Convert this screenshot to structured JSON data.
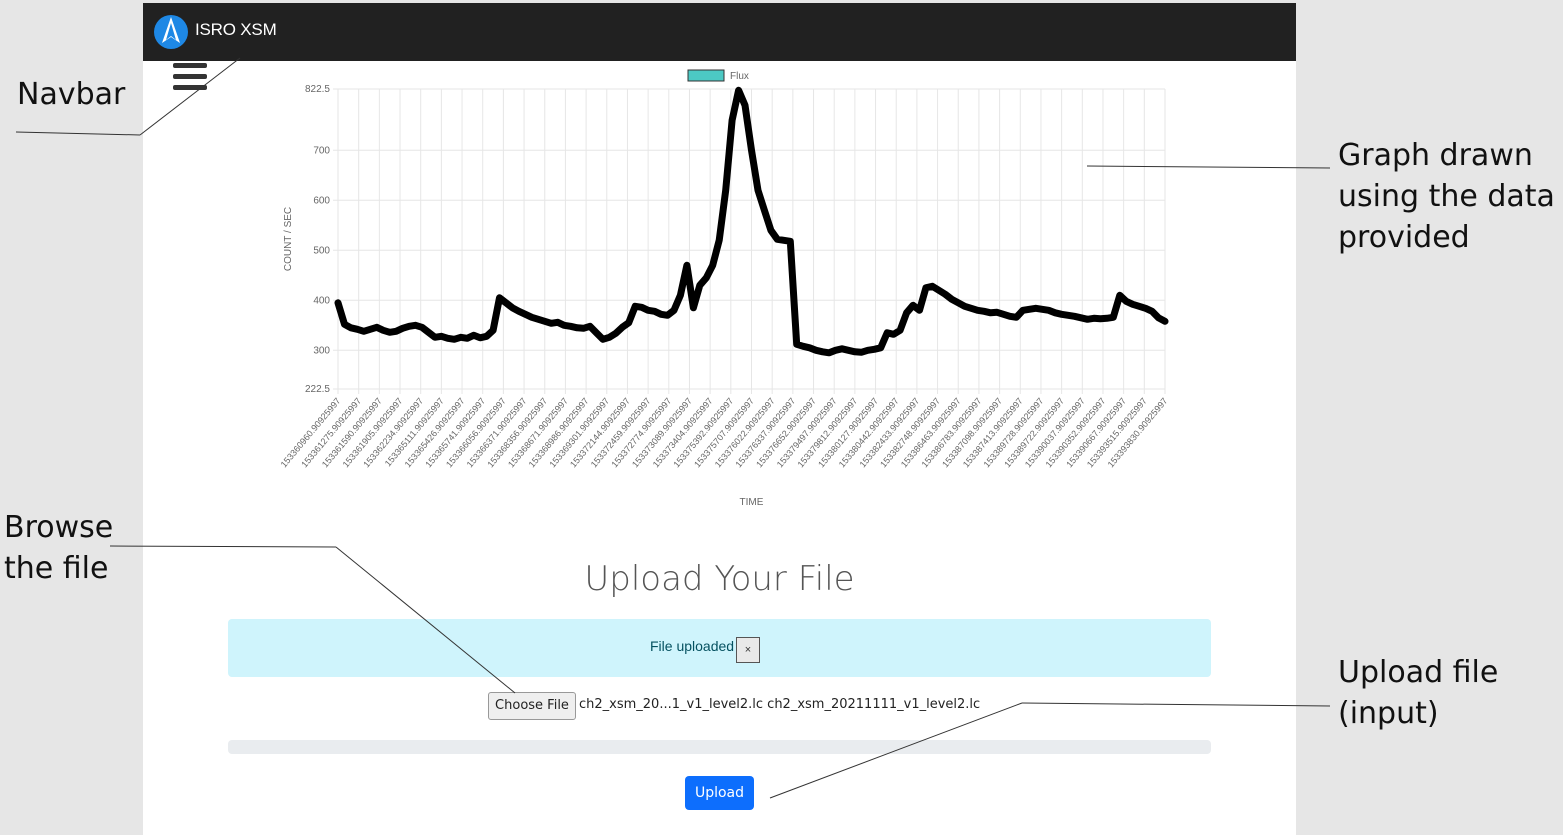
{
  "navbar": {
    "brand": "ISRO XSM",
    "logo_icon": "isro-logo-icon",
    "menu_icon": "hamburger-menu-icon",
    "background": "#212121"
  },
  "chart_data": {
    "type": "line",
    "title": "",
    "xlabel": "TIME",
    "ylabel": "COUNT / SEC",
    "ylim": [
      222.5,
      822.5
    ],
    "yticks": [
      222.5,
      300,
      400,
      500,
      600,
      700,
      822.5
    ],
    "grid": true,
    "legend_position": "top",
    "series": [
      {
        "name": "Flux",
        "legend_color": "#4cc9c4",
        "line_color": "#000000",
        "values": [
          395,
          352,
          345,
          342,
          338,
          342,
          346,
          340,
          336,
          338,
          344,
          348,
          350,
          346,
          336,
          326,
          328,
          324,
          322,
          326,
          324,
          330,
          325,
          328,
          340,
          405,
          395,
          385,
          378,
          372,
          366,
          362,
          358,
          354,
          356,
          350,
          348,
          345,
          344,
          348,
          335,
          322,
          326,
          334,
          346,
          355,
          388,
          386,
          380,
          378,
          372,
          370,
          380,
          410,
          470,
          385,
          430,
          445,
          470,
          520,
          620,
          760,
          820,
          790,
          700,
          620,
          580,
          540,
          522,
          520,
          518,
          312,
          308,
          305,
          300,
          297,
          295,
          300,
          303,
          300,
          297,
          296,
          300,
          302,
          305,
          335,
          332,
          340,
          375,
          390,
          380,
          425,
          428,
          420,
          412,
          402,
          395,
          388,
          384,
          380,
          378,
          375,
          376,
          372,
          368,
          366,
          380,
          382,
          384,
          382,
          380,
          375,
          372,
          370,
          368,
          365,
          362,
          364,
          363,
          364,
          366,
          410,
          398,
          392,
          388,
          384,
          378,
          365,
          358
        ]
      }
    ],
    "categories": [
      "153360960.90925997",
      "153361275.90925997",
      "153361590.90925997",
      "153361905.90925997",
      "153362234.90925997",
      "153365111.90925997",
      "153365426.90925997",
      "153365741.90925997",
      "153366056.90925997",
      "153366371.90925997",
      "153368356.90925997",
      "153368671.90925997",
      "153368986.90925997",
      "153369301.90925997",
      "153372144.90925997",
      "153372459.90925997",
      "153372774.90925997",
      "153373089.90925997",
      "153373404.90925997",
      "153375392.90925997",
      "153375707.90925997",
      "153376022.90925997",
      "153376337.90925997",
      "153376652.90925997",
      "153379497.90925997",
      "153379812.90925997",
      "153380127.90925997",
      "153380442.90925997",
      "153382433.90925997",
      "153382748.90925997",
      "153386463.90925997",
      "153386783.90925997",
      "153387098.90925997",
      "153387413.90925997",
      "153389728.90925997",
      "153389722.90925997",
      "153390037.90925997",
      "153390352.90925997",
      "153390667.90925997",
      "153393515.90925997",
      "153393830.90925997"
    ]
  },
  "upload": {
    "title": "Upload Your File",
    "alert_text": "File uploaded",
    "alert_close": "×",
    "choose_label": "Choose File",
    "file_names": "ch2_xsm_20...1_v1_level2.lc ch2_xsm_20211111_v1_level2.lc",
    "upload_label": "Upload",
    "progress": 0,
    "accent": "#0d6efd",
    "alert_bg": "#cff4fc"
  },
  "annotations": {
    "navbar": "Navbar",
    "graph_line1": "Graph drawn",
    "graph_line2": "using the data",
    "graph_line3": "provided",
    "browse_line1": "Browse",
    "browse_line2": "the file",
    "upload_line1": "Upload file",
    "upload_line2": "(input)"
  }
}
